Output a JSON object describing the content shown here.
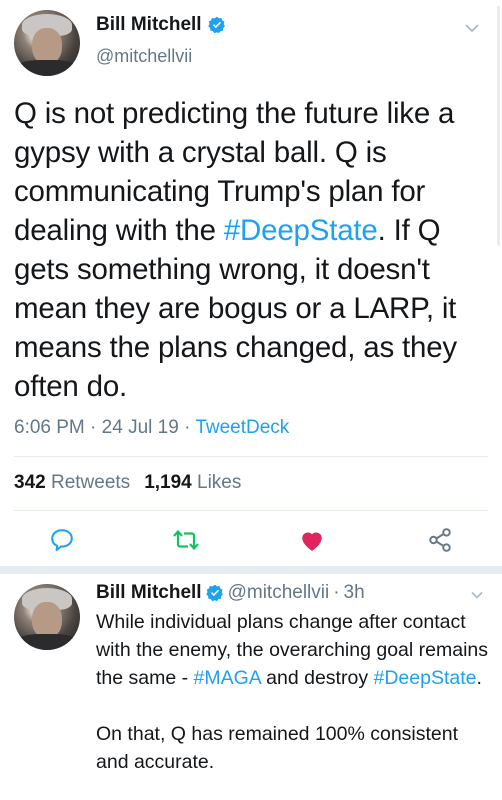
{
  "tweet": {
    "display_name": "Bill Mitchell",
    "handle": "@mitchellvii",
    "text_1": "Q is not predicting the future like a gypsy with a crystal ball.  Q is communicating Trump's plan for dealing with the ",
    "hashtag": "#DeepState",
    "text_2": ".  If Q gets something wrong, it doesn't mean they are bogus or a LARP, it means the plans changed, as they often do.",
    "time": "6:06 PM",
    "date": "24 Jul 19",
    "dot": "·",
    "source": "TweetDeck"
  },
  "stats": {
    "retweets_count": "342",
    "retweets_label": "Retweets",
    "likes_count": "1,194",
    "likes_label": "Likes"
  },
  "actions": {
    "reply": "reply-icon",
    "retweet": "retweet-icon",
    "like": "heart-icon",
    "share": "share-icon",
    "colors": {
      "retweet": "#17bf63",
      "like": "#e0245e",
      "neutral": "#1da1f2"
    }
  },
  "reply": {
    "display_name": "Bill Mitchell",
    "handle": "@mitchellvii",
    "sep": "·",
    "time": "3h",
    "text_1": "While individual plans change after contact with the enemy, the overarching goal remains the same - ",
    "hashtag_1": "#MAGA",
    "text_2": " and destroy ",
    "hashtag_2": "#DeepState",
    "text_3": ".\n\nOn that, Q has remained 100% consistent and accurate."
  },
  "colors": {
    "accent": "#1da1f2",
    "text": "#14171a",
    "muted": "#657786",
    "divider": "#e6ecf0"
  }
}
